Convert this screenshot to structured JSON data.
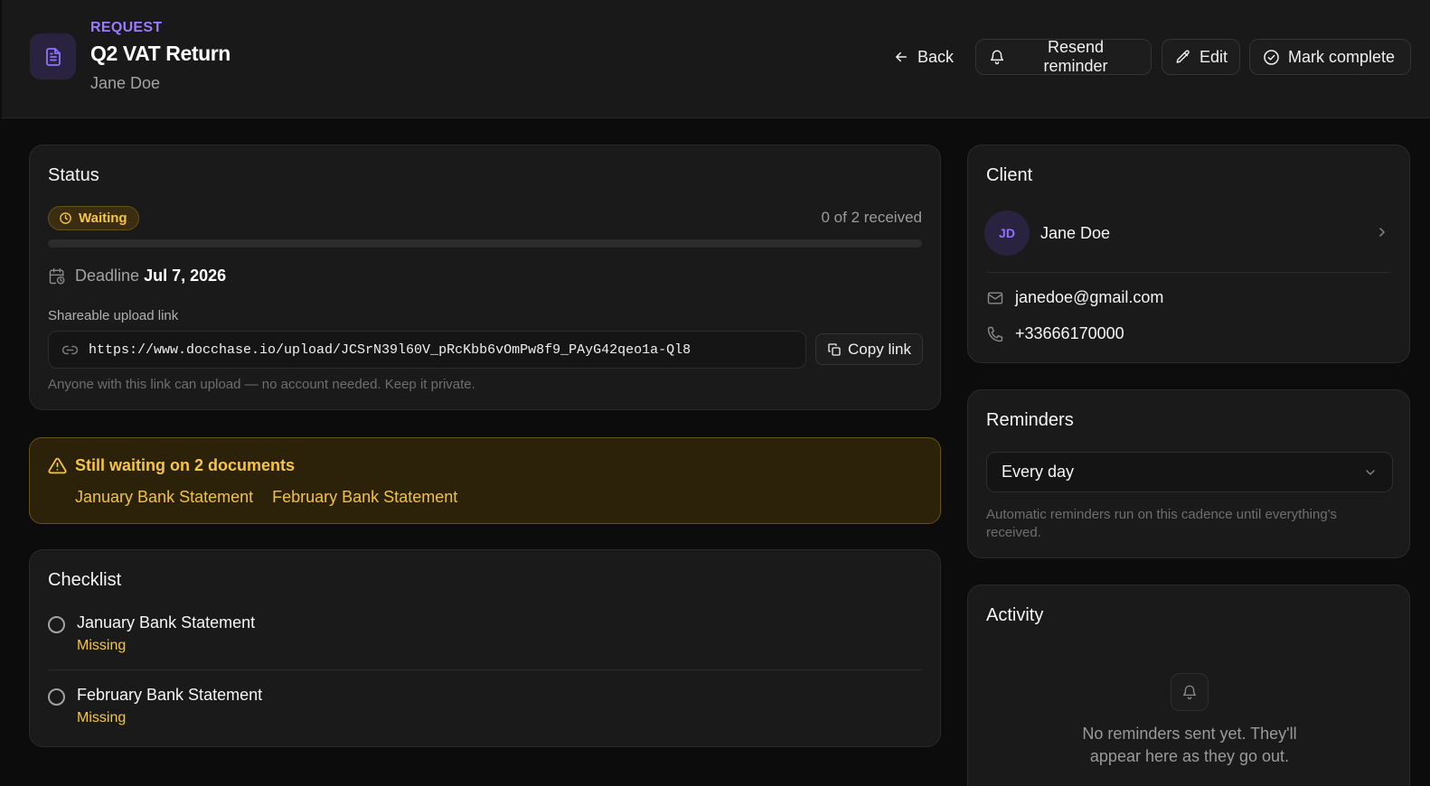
{
  "header": {
    "eyebrow": "REQUEST",
    "title": "Q2 VAT Return",
    "subtitle": "Jane Doe",
    "icon": "document-icon",
    "actions": {
      "back": "Back",
      "resend": "Resend reminder",
      "edit": "Edit",
      "complete": "Mark complete"
    }
  },
  "status": {
    "title": "Status",
    "badge": "Waiting",
    "received": "0 of 2 received",
    "progress_fraction": 0,
    "deadline_label": "Deadline",
    "deadline_value": "Jul 7, 2026",
    "share_label": "Shareable upload link",
    "share_url": "https://www.docchase.io/upload/JCSrN39l60V_pRcKbb6vOmPw8f9_PAyG42qeo1a-Ql8",
    "copy_label": "Copy link",
    "share_help": "Anyone with this link can upload — no account needed. Keep it private."
  },
  "alert": {
    "title": "Still waiting on 2 documents",
    "items": [
      "January Bank Statement",
      "February Bank Statement"
    ]
  },
  "checklist": {
    "title": "Checklist",
    "items": [
      {
        "name": "January Bank Statement",
        "status": "Missing"
      },
      {
        "name": "February Bank Statement",
        "status": "Missing"
      }
    ]
  },
  "client": {
    "title": "Client",
    "initials": "JD",
    "name": "Jane Doe",
    "email": "janedoe@gmail.com",
    "phone": "+33666170000"
  },
  "reminders": {
    "title": "Reminders",
    "selected": "Every day",
    "help": "Automatic reminders run on this cadence until everything's received."
  },
  "activity": {
    "title": "Activity",
    "empty": "No reminders sent yet. They'll appear here as they go out."
  },
  "colors": {
    "accent": "#8f72ff",
    "warning": "#f5c543",
    "background": "#0c0c0c",
    "card": "#1a1a1a"
  }
}
